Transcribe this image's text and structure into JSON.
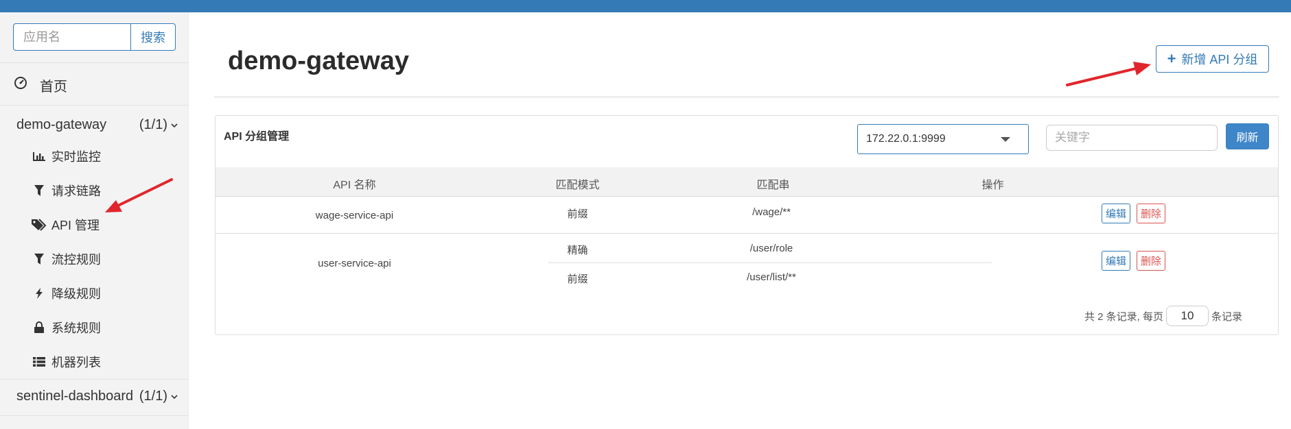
{
  "sidebar": {
    "search_placeholder": "应用名",
    "search_button": "搜索",
    "home": "首页",
    "groups": [
      {
        "name": "demo-gateway",
        "count": "(1/1)",
        "items": [
          {
            "label": "实时监控",
            "icon": "bar-chart-icon"
          },
          {
            "label": "请求链路",
            "icon": "filter-icon"
          },
          {
            "label": "API 管理",
            "icon": "tags-icon"
          },
          {
            "label": "流控规则",
            "icon": "filter-icon"
          },
          {
            "label": "降级规则",
            "icon": "flash-icon"
          },
          {
            "label": "系统规则",
            "icon": "lock-icon"
          },
          {
            "label": "机器列表",
            "icon": "list-icon"
          }
        ]
      },
      {
        "name": "sentinel-dashboard",
        "count": "(1/1)"
      }
    ]
  },
  "main": {
    "title": "demo-gateway",
    "add_button": "新增 API 分组",
    "card": {
      "title": "API 分组管理",
      "ip_selected": "172.22.0.1:9999",
      "keyword_placeholder": "关键字",
      "refresh_button": "刷新",
      "columns": [
        "API 名称",
        "匹配模式",
        "匹配串",
        "操作"
      ],
      "rows": [
        {
          "name": "wage-service-api",
          "rules": [
            {
              "mode": "前缀",
              "pattern": "/wage/**"
            }
          ]
        },
        {
          "name": "user-service-api",
          "rules": [
            {
              "mode": "精确",
              "pattern": "/user/role"
            },
            {
              "mode": "前缀",
              "pattern": "/user/list/**"
            }
          ]
        }
      ],
      "edit_label": "编辑",
      "delete_label": "删除",
      "pager_prefix": "共 2 条记录, 每页",
      "page_size": "10",
      "pager_suffix": "条记录"
    }
  },
  "colors": {
    "topbar": "#337ab7",
    "primary": "#337ab7",
    "danger": "#d9534f",
    "annotation_arrow": "#e0262b"
  }
}
